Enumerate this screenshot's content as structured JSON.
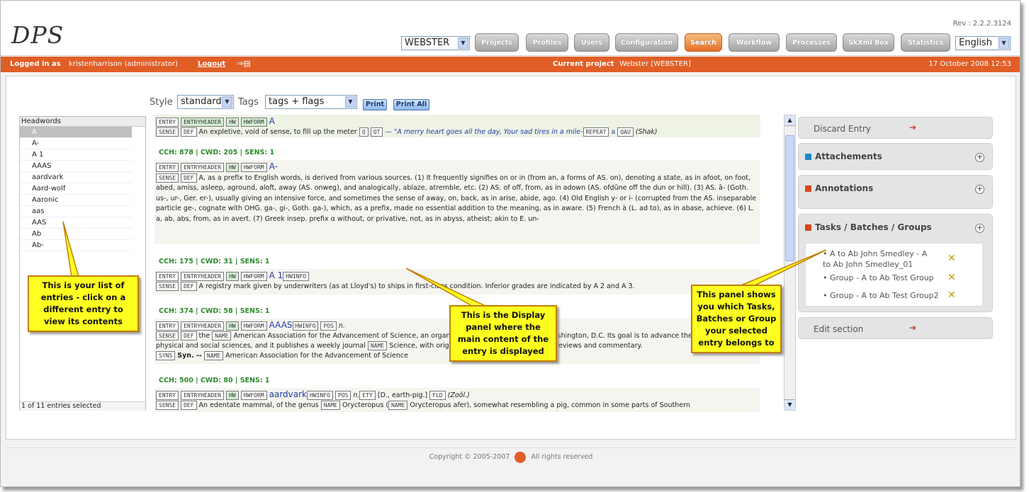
{
  "app": {
    "logo": "DPS",
    "rev": "Rev : 2.2.2.3124"
  },
  "header": {
    "project_select": "WEBSTER",
    "language_select": "English",
    "nav": [
      "Projects",
      "Profiles",
      "Users",
      "Configuration",
      "Search",
      "Workflow",
      "Processes",
      "SkXml Box",
      "Statistics"
    ]
  },
  "topbar": {
    "logged_in_label": "Logged in as",
    "user": "kristenharrison (administrator)",
    "logout": "Logout",
    "current_project_label": "Current project",
    "current_project": "Webster [WEBSTER]",
    "date": "17 October 2008 12:53"
  },
  "toolbar": {
    "style_label": "Style",
    "style_value": "standard",
    "tags_label": "Tags",
    "tags_value": "tags + flags",
    "print": "Print",
    "print_all": "Print All"
  },
  "headwords": {
    "title": "Headwords",
    "items": [
      "A",
      "A-",
      "A 1",
      "AAAS",
      "aardvark",
      "Aard-wolf",
      "Aaronic",
      "aas",
      "AAS",
      "Ab",
      "Ab-"
    ],
    "status": "1 of 11 entries selected"
  },
  "entries": {
    "e1": {
      "hw": "A",
      "def": "An expletive, void of sense, to fill up the meter",
      "quote": "— \"A merry heart goes all the day, Your sad tires in a mile-",
      "repeat": "REPEAT",
      "a": "a",
      "qau": "(Shak)"
    },
    "e2": {
      "cch": "CCH: 878",
      "cwd": "CWD: 205",
      "sens": "SENS: 1",
      "hw": "A-",
      "text": "A, as a prefix to English words, is derived from various sources. (1) It frequently signifies on or in (from an, a forms of AS. on), denoting a state, as in afoot, on foot, abed, amiss, asleep, aground, aloft, away (AS. onweg), and analogically, ablaze, atremble, etc. (2) AS. of off, from, as in adown (AS. ofdūne off the dun or hill). (3) AS. ā- (Goth. us-, ur-, Ger. er-), usually giving an intensive force, and sometimes the sense of away, on, back, as in arise, abide, ago. (4) Old English y- or i- (corrupted from the AS. inseparable particle ge-, cognate with OHG. ga-, gi-, Goth. ga-), which, as a prefix, made no essential addition to the meaning, as in aware. (5) French à (L. ad to), as in abase, achieve. (6) L. a, ab, abs, from, as in avert. (7) Greek insep. prefix α without, or privative, not, as in abyss, atheist; akin to E. un-"
    },
    "e3": {
      "cch": "CCH: 175",
      "cwd": "CWD: 31",
      "sens": "SENS: 1",
      "hw": "A 1",
      "def": "A registry mark given by underwriters (as at Lloyd's) to ships in first-class condition. Inferior grades are indicated by A 2 and A 3."
    },
    "e4": {
      "cch": "CCH: 374",
      "cwd": "CWD: 58",
      "sens": "SENS: 1",
      "hw": "AAAS",
      "pos": "n.",
      "def1": "the",
      "def2": "American Association for the Advancement of Science, an organization with headquarters in Washington, D.C. Its goal is to advance the",
      "def3": "physical and social sciences, and it publishes a weekly journal",
      "def4": "Science, with original research reports as well as reviews and commentary.",
      "syn_label": "Syn. --",
      "syn": "American Association for the Advancement of Science"
    },
    "e5": {
      "cch": "CCH: 500",
      "cwd": "CWD: 80",
      "sens": "SENS: 1",
      "hw": "aardvark",
      "pos": "n.",
      "ety": "[D., earth-pig.]",
      "fld": "(Zoöl.)",
      "def": "An edentate mammal, of the genus",
      "def2": "Orycteropus (",
      "def3": "Orycteropus afer), somewhat resembling a pig, common in some parts of Southern"
    }
  },
  "tags": {
    "entry": "ENTRY",
    "entryheader": "ENTRYHEADER",
    "hw": "HW",
    "hwform": "HWFORM",
    "sense": "SENSE",
    "def": "DEF",
    "q": "Q",
    "qt": "QT",
    "qau": "QAU",
    "xex": "XEX",
    "hwinfo": "HWINFO",
    "pos": "POS",
    "name": "NAME",
    "syns": "SYNS",
    "ety": "ETY",
    "fld": "FLD"
  },
  "right_panel": {
    "discard": "Discard Entry",
    "attachments": "Attachements",
    "annotations": "Annotations",
    "tasks": "Tasks / Batches / Groups",
    "task_items": [
      "A to Ab John Smedley - A to Ab John Smedley_01",
      "Group - A to Ab Test Group",
      "Group - A to Ab Test Group2"
    ],
    "edit": "Edit section"
  },
  "callouts": {
    "list": "This is your list of entries - click on a different entry to view its contents",
    "display": "This is the Display panel where the main content of the entry is displayed",
    "tasks": "This panel shows you which Tasks, Batches or Group your selected entry belongs to"
  },
  "footer": {
    "copyright": "Copyright © 2005-2007",
    "rights": "All rights reserved"
  },
  "colors": {
    "orange_bar": "#e15e26",
    "active_tab": "#e46f28",
    "callout": "#ffff20",
    "green_meta": "#2e8b2e"
  }
}
